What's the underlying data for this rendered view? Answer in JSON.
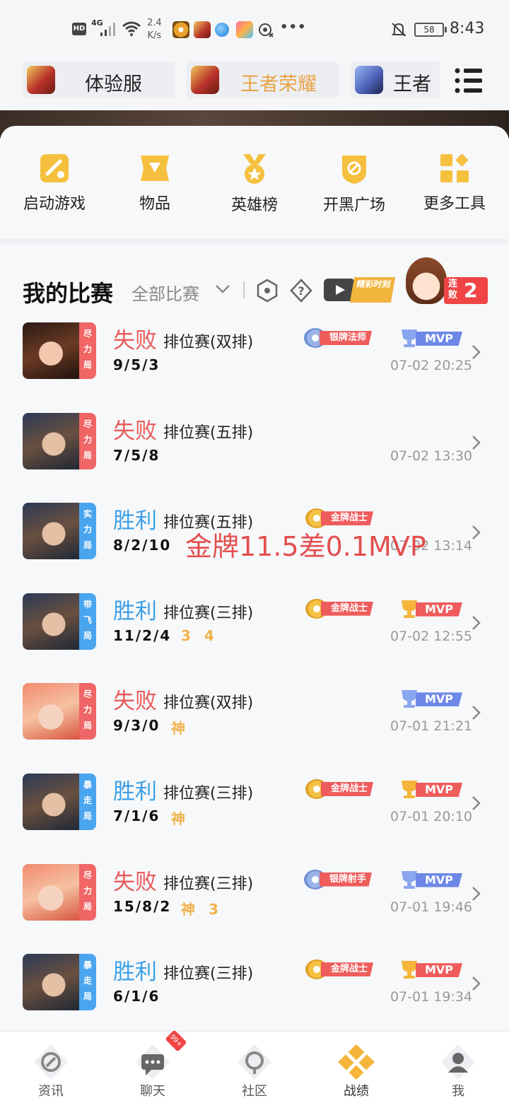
{
  "status_bar": {
    "hd": "HD",
    "network": "4G",
    "speed_value": "2.4",
    "speed_unit": "K/s",
    "dots": "•••",
    "battery": "58",
    "time": "8:43",
    "app_icons": [
      "app-icon-1",
      "app-icon-2",
      "app-icon-3",
      "app-icon-4",
      "app-icon-5"
    ]
  },
  "game_tabs": [
    {
      "label": "体验服",
      "active": false
    },
    {
      "label": "王者荣耀",
      "active": true
    },
    {
      "label": "王者",
      "active": false
    }
  ],
  "tools": [
    {
      "label": "启动游戏",
      "icon": "launch-game-icon"
    },
    {
      "label": "物品",
      "icon": "items-icon"
    },
    {
      "label": "英雄榜",
      "icon": "hero-rank-icon"
    },
    {
      "label": "开黑广场",
      "icon": "team-square-icon"
    },
    {
      "label": "更多工具",
      "icon": "more-tools-icon"
    }
  ],
  "section": {
    "title": "我的比赛",
    "filter": "全部比赛",
    "highlight_tag": "精彩时刻",
    "streak_label": "连败",
    "streak_count": "2"
  },
  "matches": [
    {
      "result": "失败",
      "mode": "排位赛(双排)",
      "kda": "9/5/3",
      "extra": "",
      "time": "07-02 20:25",
      "perf": "尽力局",
      "badge": "银牌法师",
      "mvp": "MVP"
    },
    {
      "result": "失败",
      "mode": "排位赛(五排)",
      "kda": "7/5/8",
      "extra": "",
      "time": "07-02 13:30",
      "perf": "尽力局",
      "badge": "",
      "mvp": ""
    },
    {
      "result": "胜利",
      "mode": "排位赛(五排)",
      "kda": "8/2/10",
      "extra": "",
      "time": "07-02 13:14",
      "perf": "实力局",
      "badge": "金牌战士",
      "mvp": ""
    },
    {
      "result": "胜利",
      "mode": "排位赛(三排)",
      "kda": "11/2/4",
      "extra": "3 4",
      "time": "07-02 12:55",
      "perf": "带飞局",
      "badge": "金牌战士",
      "mvp": "MVP"
    },
    {
      "result": "失败",
      "mode": "排位赛(双排)",
      "kda": "9/3/0",
      "extra": "神",
      "time": "07-01 21:21",
      "perf": "尽力局",
      "badge": "",
      "mvp": "MVP"
    },
    {
      "result": "胜利",
      "mode": "排位赛(三排)",
      "kda": "7/1/6",
      "extra": "神",
      "time": "07-01 20:10",
      "perf": "暴走局",
      "badge": "金牌战士",
      "mvp": "MVP"
    },
    {
      "result": "失败",
      "mode": "排位赛(三排)",
      "kda": "15/8/2",
      "extra": "神 3",
      "time": "07-01 19:46",
      "perf": "尽力局",
      "badge": "银牌射手",
      "mvp": "MVP"
    },
    {
      "result": "胜利",
      "mode": "排位赛(三排)",
      "kda": "6/1/6",
      "extra": "",
      "time": "07-01 19:34",
      "perf": "暴走局",
      "badge": "金牌战士",
      "mvp": "MVP"
    }
  ],
  "overlay_text": "金牌11.5差0.1MVP",
  "bottom_nav": [
    {
      "label": "资讯",
      "icon": "news-icon"
    },
    {
      "label": "聊天",
      "icon": "chat-icon",
      "badge": "99+"
    },
    {
      "label": "社区",
      "icon": "community-icon"
    },
    {
      "label": "战绩",
      "icon": "record-icon",
      "active": true
    },
    {
      "label": "我",
      "icon": "profile-icon"
    }
  ],
  "colors": {
    "accent": "#f0b24a",
    "lose": "#e85b5b",
    "win": "#3da0e6",
    "badge_red": "#ef5c5c",
    "mvp_blue": "#6d88e6"
  }
}
